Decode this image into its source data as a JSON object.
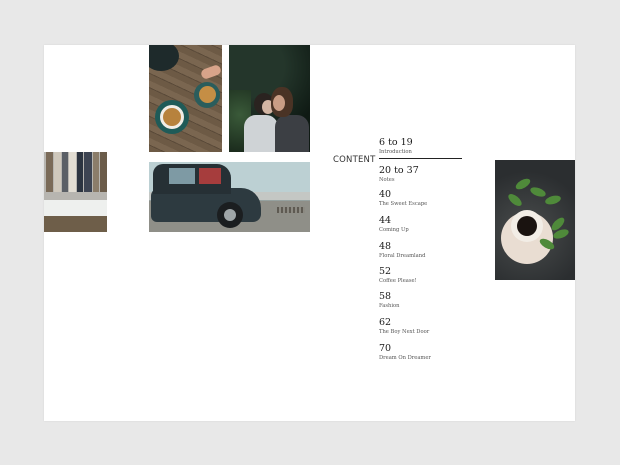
{
  "toc": {
    "heading": "CONTENT",
    "entries": [
      {
        "pages": "6 to 19",
        "title": "Introduction"
      },
      {
        "pages": "20 to 37",
        "title": "Notes"
      },
      {
        "pages": "40",
        "title": "The Sweet Escape"
      },
      {
        "pages": "44",
        "title": "Coming Up"
      },
      {
        "pages": "48",
        "title": "Floral Dreamland"
      },
      {
        "pages": "52",
        "title": "Coffee Please!"
      },
      {
        "pages": "58",
        "title": "Fashion"
      },
      {
        "pages": "62",
        "title": "The Boy Next Door"
      },
      {
        "pages": "70",
        "title": "Dream On Dreamer"
      }
    ]
  },
  "photos": [
    {
      "subject": "coffee-cups-on-wooden-table"
    },
    {
      "subject": "couple-embracing"
    },
    {
      "subject": "clothes-rack"
    },
    {
      "subject": "vintage-car"
    },
    {
      "subject": "coffee-cup-with-leaves"
    }
  ],
  "colors": {
    "background": "#e8e8e8",
    "page": "#ffffff",
    "text": "#1a1a1a"
  }
}
